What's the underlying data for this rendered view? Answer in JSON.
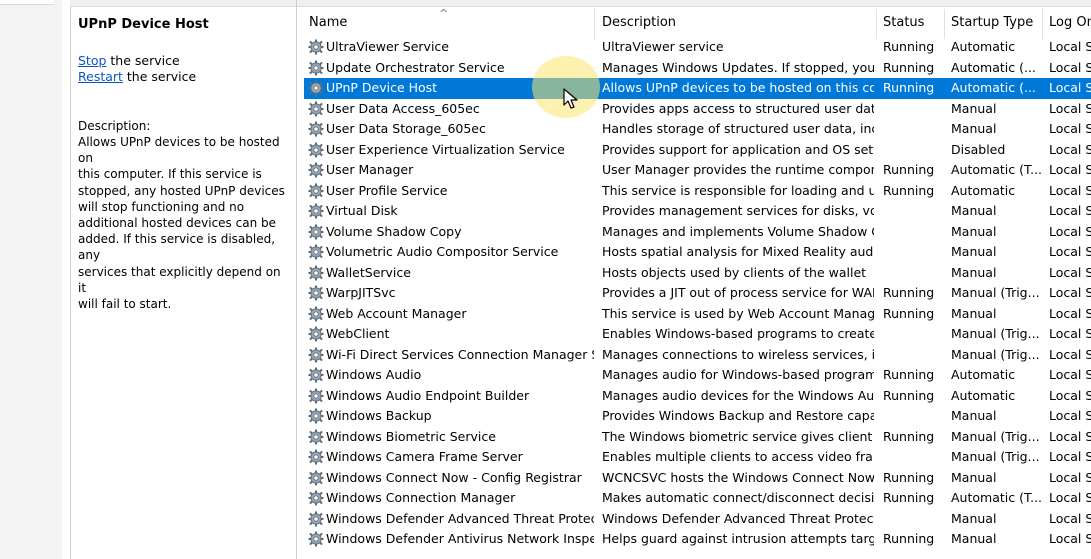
{
  "description_pane": {
    "title": "UPnP Device Host",
    "stop_link": "Stop",
    "stop_suffix": " the service",
    "restart_link": "Restart",
    "restart_suffix": " the service",
    "description_label": "Description:",
    "description_lines": [
      "Allows UPnP devices to be hosted on",
      "this computer. If this service is",
      "stopped, any hosted UPnP devices",
      "will stop functioning and no",
      "additional hosted devices can be",
      "added. If this service is disabled, any",
      "services that explicitly depend on it",
      "will fail to start."
    ]
  },
  "columns": {
    "name": "Name",
    "description": "Description",
    "status": "Status",
    "startup_type": "Startup Type",
    "log_on_as": "Log On"
  },
  "selected_index": 2,
  "services": [
    {
      "name": "UltraViewer Service",
      "description": "UltraViewer service",
      "status": "Running",
      "startup": "Automatic",
      "logon": "Local Sy"
    },
    {
      "name": "Update Orchestrator Service",
      "description": "Manages Windows Updates. If stopped, your ...",
      "status": "Running",
      "startup": "Automatic (...",
      "logon": "Local Sy"
    },
    {
      "name": "UPnP Device Host",
      "description": "Allows UPnP devices to be hosted on this co...",
      "status": "Running",
      "startup": "Automatic (...",
      "logon": "Local Se"
    },
    {
      "name": "User Data Access_605ec",
      "description": "Provides apps access to structured user data, ...",
      "status": "",
      "startup": "Manual",
      "logon": "Local Sy"
    },
    {
      "name": "User Data Storage_605ec",
      "description": "Handles storage of structured user data, inclu...",
      "status": "",
      "startup": "Manual",
      "logon": "Local Sy"
    },
    {
      "name": "User Experience Virtualization Service",
      "description": "Provides support for application and OS setti...",
      "status": "",
      "startup": "Disabled",
      "logon": "Local Sy"
    },
    {
      "name": "User Manager",
      "description": "User Manager provides the runtime compon...",
      "status": "Running",
      "startup": "Automatic (T...",
      "logon": "Local Sy"
    },
    {
      "name": "User Profile Service",
      "description": "This service is responsible for loading and unl...",
      "status": "Running",
      "startup": "Automatic",
      "logon": "Local Sy"
    },
    {
      "name": "Virtual Disk",
      "description": "Provides management services for disks, volu...",
      "status": "",
      "startup": "Manual",
      "logon": "Local Sy"
    },
    {
      "name": "Volume Shadow Copy",
      "description": "Manages and implements Volume Shadow C...",
      "status": "",
      "startup": "Manual",
      "logon": "Local Sy"
    },
    {
      "name": "Volumetric Audio Compositor Service",
      "description": "Hosts spatial analysis for Mixed Reality audio ...",
      "status": "",
      "startup": "Manual",
      "logon": "Local Se"
    },
    {
      "name": "WalletService",
      "description": "Hosts objects used by clients of the wallet",
      "status": "",
      "startup": "Manual",
      "logon": "Local Sy"
    },
    {
      "name": "WarpJITSvc",
      "description": "Provides a JIT out of process service for WAR...",
      "status": "Running",
      "startup": "Manual (Trig...",
      "logon": "Local Se"
    },
    {
      "name": "Web Account Manager",
      "description": "This service is used by Web Account Manage...",
      "status": "Running",
      "startup": "Manual",
      "logon": "Local Sy"
    },
    {
      "name": "WebClient",
      "description": "Enables Windows-based programs to create, ...",
      "status": "",
      "startup": "Manual (Trig...",
      "logon": "Local Se"
    },
    {
      "name": "Wi-Fi Direct Services Connection Manager Se...",
      "description": "Manages connections to wireless services, in...",
      "status": "",
      "startup": "Manual (Trig...",
      "logon": "Local Se"
    },
    {
      "name": "Windows Audio",
      "description": "Manages audio for Windows-based program...",
      "status": "Running",
      "startup": "Automatic",
      "logon": "Local Se"
    },
    {
      "name": "Windows Audio Endpoint Builder",
      "description": "Manages audio devices for the Windows Aud...",
      "status": "Running",
      "startup": "Automatic",
      "logon": "Local Sy"
    },
    {
      "name": "Windows Backup",
      "description": "Provides Windows Backup and Restore capab...",
      "status": "",
      "startup": "Manual",
      "logon": "Local Sy"
    },
    {
      "name": "Windows Biometric Service",
      "description": "The Windows biometric service gives client a...",
      "status": "Running",
      "startup": "Manual (Trig...",
      "logon": "Local Sy"
    },
    {
      "name": "Windows Camera Frame Server",
      "description": "Enables multiple clients to access video fram...",
      "status": "",
      "startup": "Manual (Trig...",
      "logon": "Local Se"
    },
    {
      "name": "Windows Connect Now - Config Registrar",
      "description": "WCNCSVC hosts the Windows Connect Now ...",
      "status": "Running",
      "startup": "Manual",
      "logon": "Local Se"
    },
    {
      "name": "Windows Connection Manager",
      "description": "Makes automatic connect/disconnect decisi...",
      "status": "Running",
      "startup": "Automatic (T...",
      "logon": "Local Se"
    },
    {
      "name": "Windows Defender Advanced Threat Protecti...",
      "description": "Windows Defender Advanced Threat Protecti...",
      "status": "",
      "startup": "Manual",
      "logon": "Local Sy"
    },
    {
      "name": "Windows Defender Antivirus Network Inspec...",
      "description": "Helps guard against intrusion attempts target...",
      "status": "Running",
      "startup": "Manual",
      "logon": "Local Se"
    }
  ]
}
